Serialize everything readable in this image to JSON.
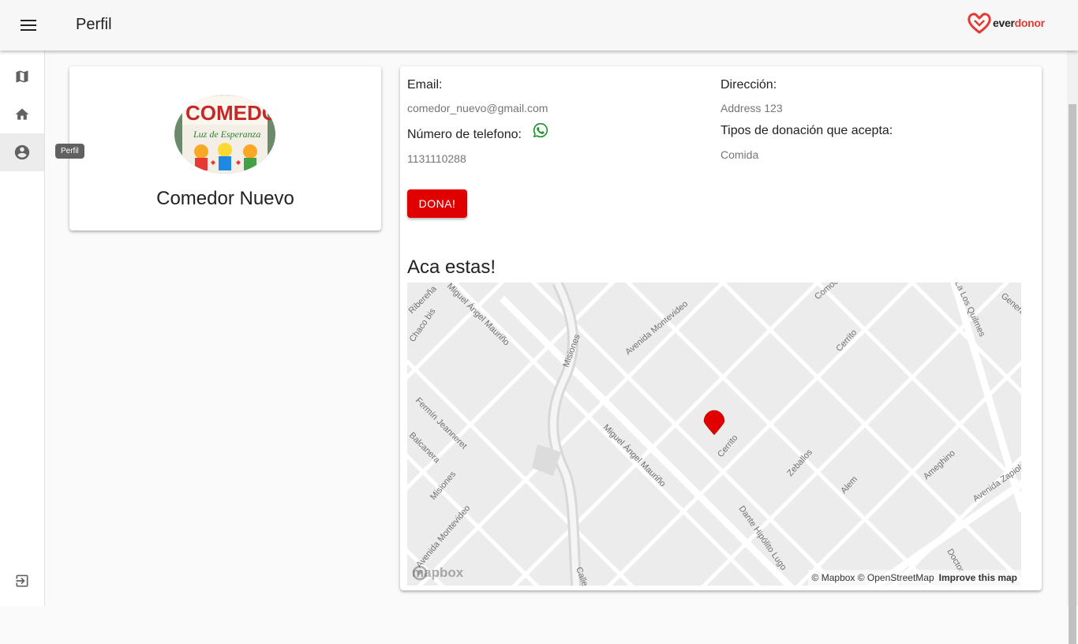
{
  "appbar": {
    "title": "Perfil",
    "logo_text_ever": "ever",
    "logo_text_donor": "donor",
    "logo_color": "#e53935"
  },
  "drawer": {
    "items": [
      {
        "name": "map",
        "icon": "map-icon"
      },
      {
        "name": "home",
        "icon": "home-icon"
      },
      {
        "name": "profile",
        "icon": "account-circle-icon"
      }
    ],
    "tooltip": "Perfil",
    "logout_icon": "logout-icon"
  },
  "profile": {
    "name": "Comedor Nuevo",
    "avatar_text_top": "COMEDOR",
    "avatar_text_bottom": "Luz de Esperanza"
  },
  "info": {
    "email_label": "Email:",
    "email_value": "comedor_nuevo@gmail.com",
    "phone_label": "Número de telefono:",
    "phone_value": "1131110288",
    "address_label": "Dirección:",
    "address_value": "Address 123",
    "donation_types_label": "Tipos de donación que acepta:",
    "donation_types_value": "Comida",
    "donate_button": "DONA!",
    "whatsapp_icon": "whatsapp-icon"
  },
  "map": {
    "heading": "Aca estas!",
    "streets": [
      "Ribereña",
      "Miguel Ángel Mauriño",
      "Chaco bis",
      "Misiones",
      "Avenida Montevideo",
      "Cerrito",
      "Zeballos",
      "Alem",
      "Ameghino",
      "Avenida Zapiola",
      "La Los Quilmes",
      "General",
      "Fermín Jeanneret",
      "Balcanera",
      "Dante Hipólito Lugo",
      "Doctor",
      "Calle",
      "Comodoro",
      "Zapiola"
    ],
    "mapbox_logo": "mapbox",
    "attribution": "© Mapbox © OpenStreetMap",
    "improve_link": "Improve this map",
    "marker_color": "#e00000"
  }
}
